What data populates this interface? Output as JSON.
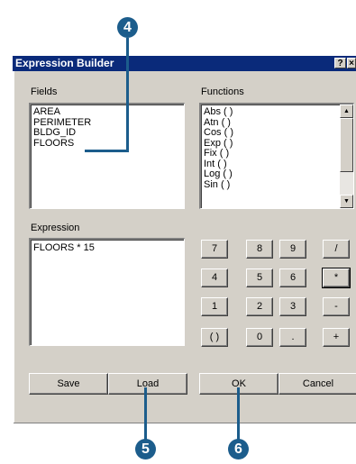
{
  "dialog": {
    "title": "Expression Builder",
    "help_label": "?",
    "close_label": "×"
  },
  "fields": {
    "label": "Fields",
    "items": [
      "AREA",
      "PERIMETER",
      "BLDG_ID",
      "FLOORS"
    ]
  },
  "functions": {
    "label": "Functions",
    "items": [
      "Abs ( )",
      "Atn ( )",
      "Cos ( )",
      "Exp ( )",
      "Fix ( )",
      "Int ( )",
      "Log ( )",
      "Sin ( )"
    ]
  },
  "expression": {
    "label": "Expression",
    "value": "FLOORS * 15"
  },
  "keypad": {
    "row1": [
      "7",
      "8",
      "9",
      "/"
    ],
    "row2": [
      "4",
      "5",
      "6",
      "*"
    ],
    "row3": [
      "1",
      "2",
      "3",
      "-"
    ],
    "row4": [
      "( )",
      "0",
      ".",
      "+"
    ]
  },
  "buttons": {
    "save": "Save",
    "load": "Load",
    "ok": "OK",
    "cancel": "Cancel"
  },
  "callouts": {
    "fields_step": "4",
    "load_step": "5",
    "ok_step": "6"
  },
  "colors": {
    "callout": "#1c5d8c",
    "titlebar": "#0a2a7a",
    "dialog_face": "#d4d0c8"
  }
}
